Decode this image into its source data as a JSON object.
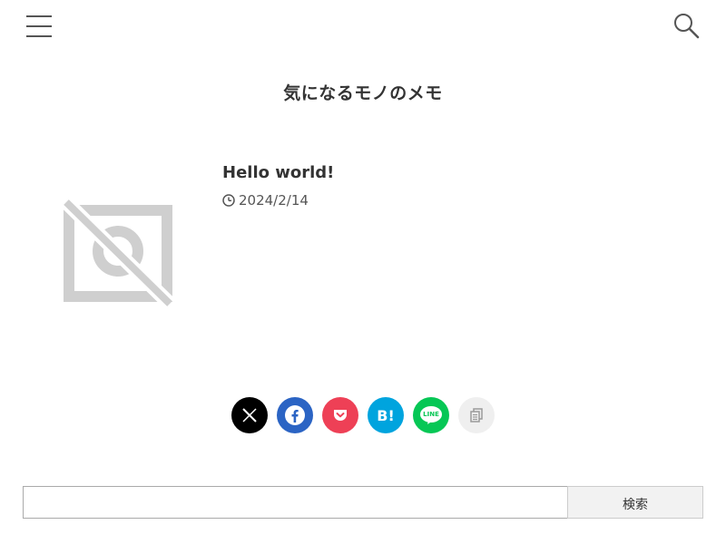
{
  "header": {
    "menu_icon": "hamburger-icon",
    "search_icon": "search-icon",
    "site_title": "気になるモノのメモ"
  },
  "post": {
    "title": "Hello world!",
    "date": "2024/2/14",
    "thumbnail_icon": "no-photo-icon",
    "date_icon": "clock-icon"
  },
  "share": [
    {
      "name": "x",
      "icon": "x-logo-icon",
      "color": "#000000"
    },
    {
      "name": "facebook",
      "icon": "facebook-icon",
      "color": "#2b64c4"
    },
    {
      "name": "pocket",
      "icon": "pocket-icon",
      "color": "#ee4056"
    },
    {
      "name": "hatena",
      "label": "B!",
      "icon": "hatena-bookmark-icon",
      "color": "#00a4de"
    },
    {
      "name": "line",
      "label": "LINE",
      "icon": "line-icon",
      "color": "#06c755"
    },
    {
      "name": "copy",
      "icon": "copy-icon",
      "color": "#efefef"
    }
  ],
  "search": {
    "value": "",
    "submit_label": "検索"
  }
}
